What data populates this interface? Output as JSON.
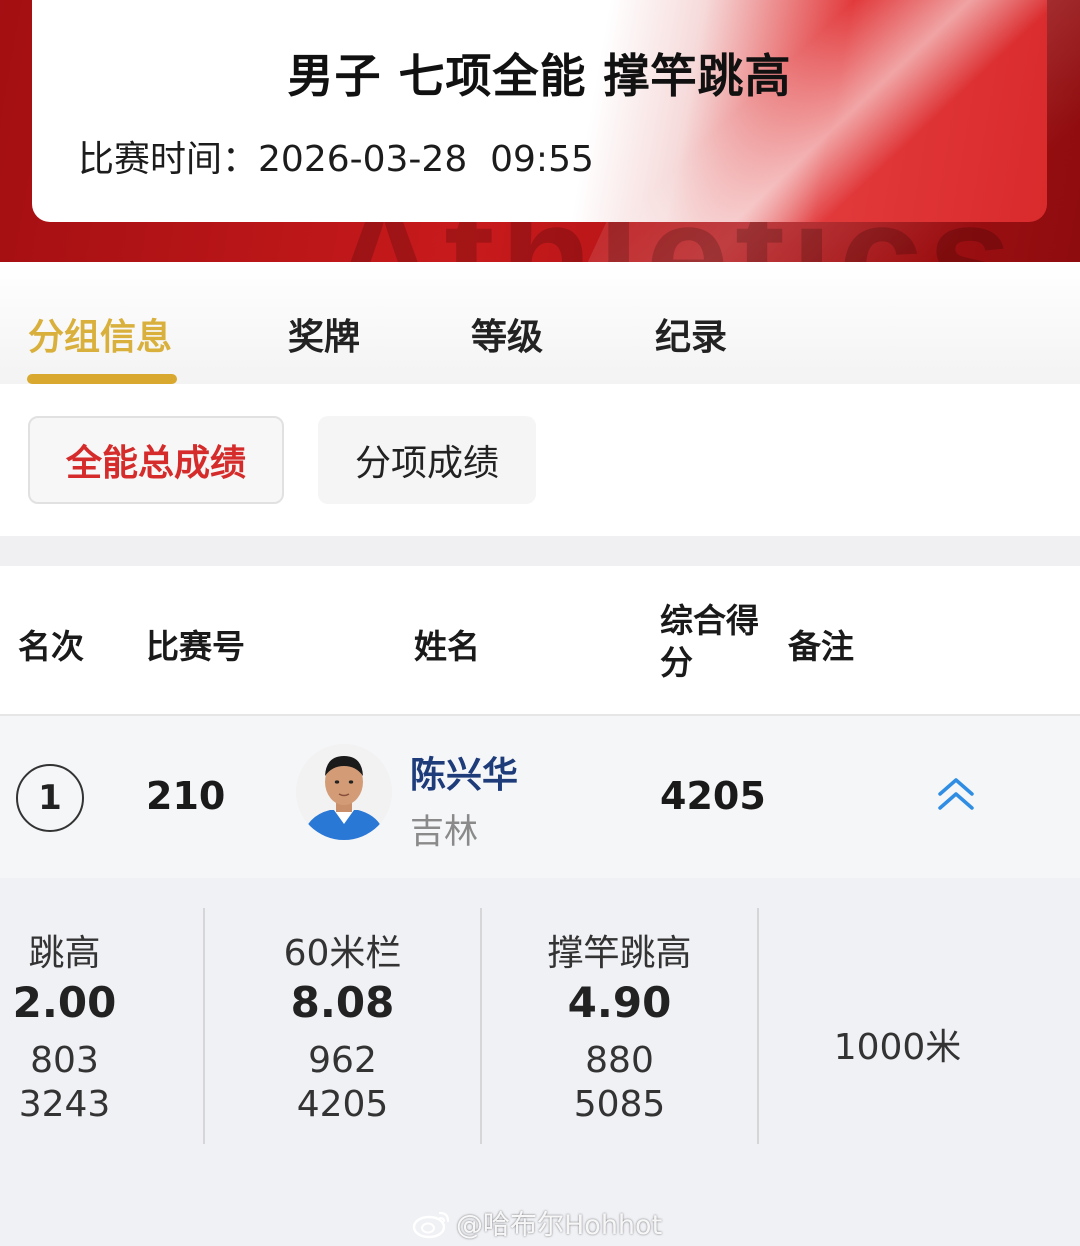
{
  "banner": {
    "background_text": "Athletics"
  },
  "event": {
    "title": "男子 七项全能 撑竿跳高",
    "time_label": "比赛时间：",
    "date": "2026-03-28",
    "time": "09:55"
  },
  "tabs": [
    {
      "label": "分组信息",
      "active": true
    },
    {
      "label": "奖牌",
      "active": false
    },
    {
      "label": "等级",
      "active": false
    },
    {
      "label": "纪录",
      "active": false
    }
  ],
  "subtabs": [
    {
      "label": "全能总成绩",
      "active": true
    },
    {
      "label": "分项成绩",
      "active": false
    }
  ],
  "table": {
    "headers": {
      "rank": "名次",
      "bib": "比赛号",
      "name": "姓名",
      "score": "综合得分",
      "note": "备注"
    },
    "rows": [
      {
        "rank": "1",
        "bib": "210",
        "name": "陈兴华",
        "team": "吉林",
        "total": "4205",
        "expanded": true,
        "details": [
          {
            "event": "跳高",
            "result": "2.00",
            "points": "803",
            "cumulative": "3243"
          },
          {
            "event": "60米栏",
            "result": "8.08",
            "points": "962",
            "cumulative": "4205"
          },
          {
            "event": "撑竿跳高",
            "result": "4.90",
            "points": "880",
            "cumulative": "5085"
          },
          {
            "event": "1000米"
          }
        ]
      }
    ]
  },
  "watermark": "@哈布尔Hohhot",
  "colors": {
    "accent_gold": "#d9a92f",
    "active_red": "#d52b2b",
    "banner_red": "#c81a1c",
    "name_blue": "#1e3c7a",
    "expand_blue": "#2f8de4"
  },
  "icons": {
    "expand": "chevron-double-up-icon",
    "weibo": "weibo-logo-icon"
  }
}
